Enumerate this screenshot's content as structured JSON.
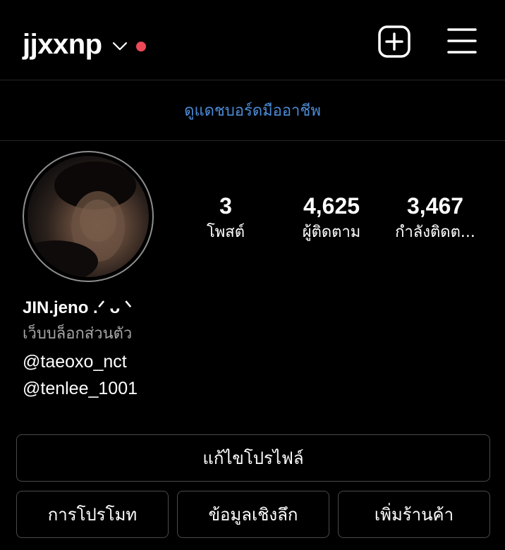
{
  "header": {
    "username": "jjxxnp",
    "notification_dot_color": "#ed4956",
    "chevron_icon": "chevron-down-icon",
    "add_icon": "plus-square-icon",
    "menu_icon": "hamburger-menu-icon"
  },
  "dashboard_link": "ดูแดชบอร์ดมืออาชีพ",
  "profile": {
    "avatar_icon": "profile-photo"
  },
  "stats": [
    {
      "count": "3",
      "label": "โพสต์"
    },
    {
      "count": "4,625",
      "label": "ผู้ติดตาม"
    },
    {
      "count": "3,467",
      "label": "กำลังติดต..."
    }
  ],
  "bio": {
    "display_name": "JIN.jeno .ᐟ ᴗ ᐠ",
    "category": "เว็บบล็อกส่วนตัว",
    "mentions": [
      "@taeoxo_nct",
      "@tenlee_1001"
    ]
  },
  "buttons": {
    "edit_profile": "แก้ไขโปรไฟล์",
    "promotions": "การโปรโมท",
    "insights": "ข้อมูลเชิงลึก",
    "add_shop": "เพิ่มร้านค้า"
  },
  "colors": {
    "background": "#000000",
    "link": "#4b8bd6",
    "secondary_text": "#a8a8a8",
    "button_border": "#4a4a4a"
  }
}
